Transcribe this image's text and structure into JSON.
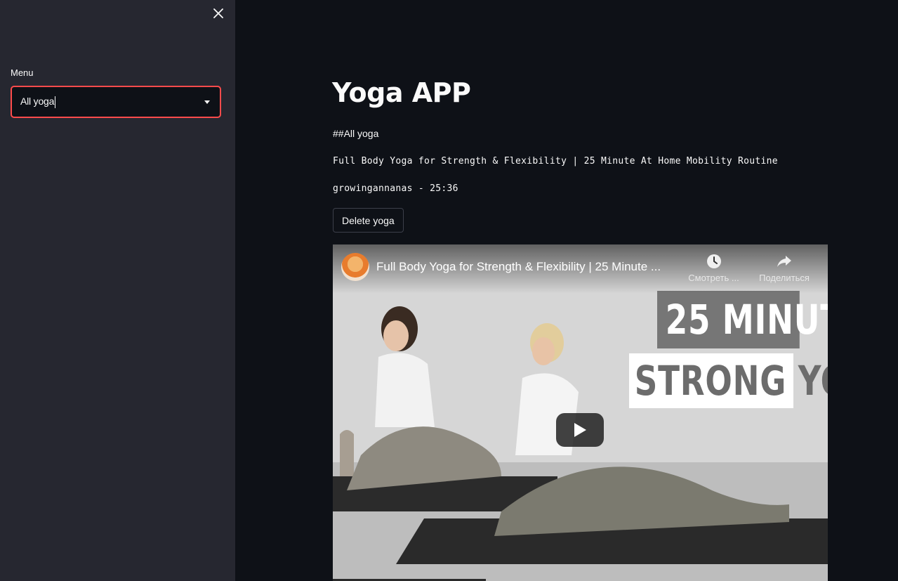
{
  "sidebar": {
    "menu_label": "Menu",
    "select_value": "All yoga",
    "close_icon": "close-icon"
  },
  "main": {
    "title": "Yoga APP",
    "subheading": "##All yoga",
    "video_title": "Full Body Yoga for Strength & Flexibility | 25 Minute At Home Mobility Routine",
    "author_line": "growingannanas - 25:36",
    "delete_button": "Delete yoga"
  },
  "video": {
    "title": "Full Body Yoga for Strength & Flexibility | 25 Minute ...",
    "watch_later_label": "Смотреть ...",
    "share_label": "Поделиться",
    "thumbnail_text_line1": "25 MINUT",
    "thumbnail_text_line2": "STRONG YO",
    "icons": [
      "clock-icon",
      "share-arrow-icon",
      "play-icon"
    ]
  },
  "colors": {
    "background": "#0e1117",
    "sidebar": "#262730",
    "accent_border": "#ff4b4b",
    "text": "#fafafa"
  }
}
